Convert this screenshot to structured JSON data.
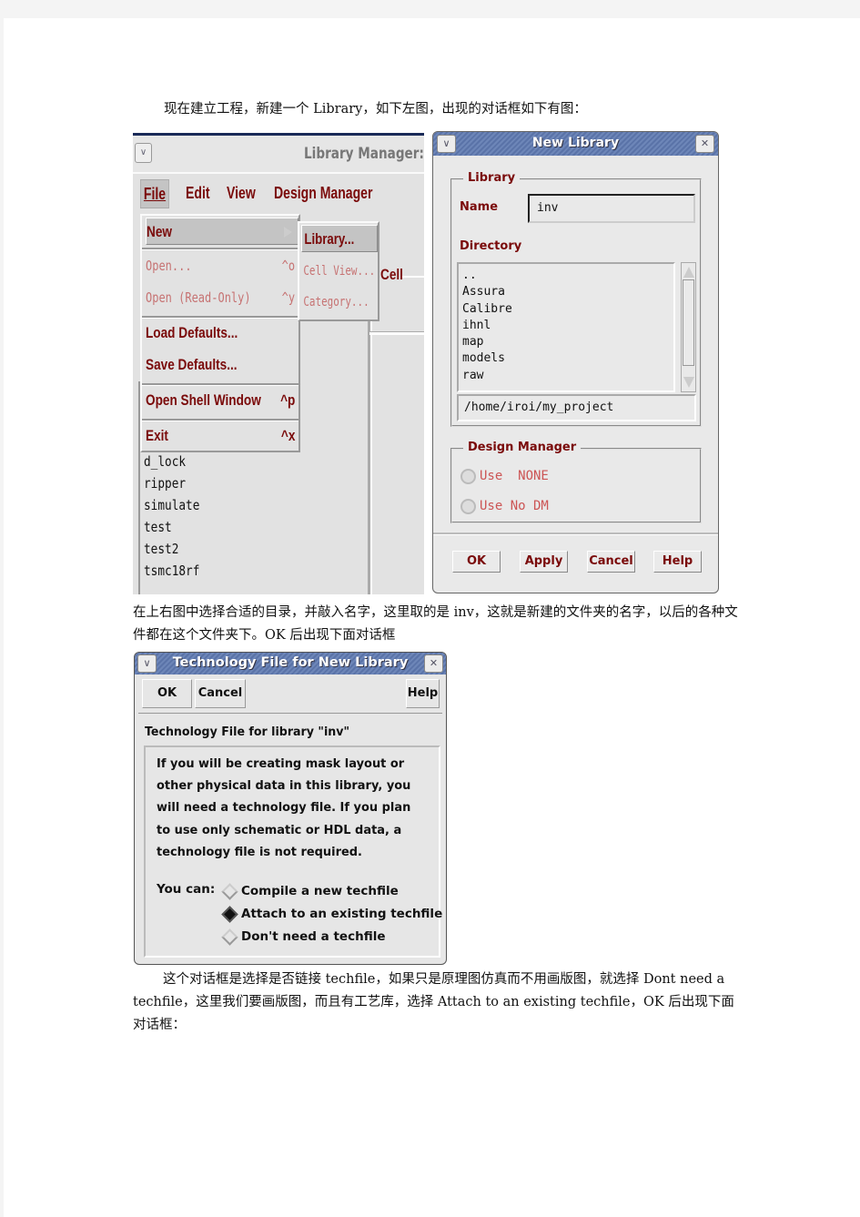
{
  "document": {
    "paragraph_1": "现在建立工程，新建一个 Library，如下左图，出现的对话框如下有图：",
    "paragraph_2": "在上右图中选择合适的目录，并敲入名字，这里取的是 inv，这就是新建的文件夹的名字，以后的各种文件都在这个文件夹下。OK 后出现下面对话框",
    "paragraph_3": "这个对话框是选择是否链接 techfile，如果只是原理图仿真而不用画版图，就选择 Dont need a techfile，这里我们要画版图，而且有工艺库，选择 Attach to an existing techfile，OK 后出现下面对话框："
  },
  "library_manager": {
    "window_menu_icon": "chevron-down-icon",
    "title": "Library Manager: W",
    "menubar": [
      {
        "label": "File",
        "mnemonic": "F"
      },
      {
        "label": "Edit",
        "mnemonic": "E"
      },
      {
        "label": "View",
        "mnemonic": "V"
      },
      {
        "label": "Design Manager",
        "mnemonic": "D"
      }
    ],
    "cell_label": "Cell",
    "file_menu": {
      "items": [
        {
          "label": "New",
          "shortcut": "",
          "state": "highlighted",
          "has_submenu": true
        },
        {
          "label": "Open...",
          "shortcut": "^o",
          "state": "disabled"
        },
        {
          "label": "Open (Read-Only)",
          "shortcut": "^y",
          "state": "disabled"
        },
        {
          "label": "Load Defaults...",
          "shortcut": "",
          "state": "enabled"
        },
        {
          "label": "Save Defaults...",
          "shortcut": "",
          "state": "enabled"
        },
        {
          "label": "Open Shell Window",
          "shortcut": "^p",
          "state": "enabled"
        },
        {
          "label": "Exit",
          "shortcut": "^x",
          "state": "enabled"
        }
      ]
    },
    "new_submenu": {
      "items": [
        {
          "label": "Library...",
          "state": "highlighted"
        },
        {
          "label": "Cell View...",
          "state": "disabled"
        },
        {
          "label": "Category...",
          "state": "disabled"
        }
      ]
    },
    "library_list": [
      "d_lock",
      "ripper",
      "simulate",
      "test",
      "test2",
      "tsmc18rf"
    ]
  },
  "new_library_dialog": {
    "title": "New Library",
    "window_menu_icon": "chevron-down-icon",
    "close_icon": "close-icon",
    "library_group": "Library",
    "name_label": "Name",
    "name_value": "inv",
    "directory_label": "Directory",
    "directory_items": [
      "..",
      "Assura",
      "Calibre",
      "ihnl",
      "map",
      "models",
      "raw"
    ],
    "directory_path": "/home/iroi/my_project",
    "design_manager_group": "Design Manager",
    "dm_options": [
      {
        "label": "Use  NONE",
        "selected": false,
        "enabled": false
      },
      {
        "label": "Use No DM",
        "selected": false,
        "enabled": false
      }
    ],
    "buttons": {
      "ok": "OK",
      "apply": "Apply",
      "cancel": "Cancel",
      "help": "Help"
    }
  },
  "techfile_dialog": {
    "title": "Technology File for New Library",
    "buttons": {
      "ok": "OK",
      "cancel": "Cancel",
      "help": "Help"
    },
    "heading": "Technology File for library \"inv\"",
    "message": "If you will be creating mask layout or other physical data in this library, you will need a technology file. If you plan to use only schematic or HDL data, a technology file is not required.",
    "you_can_label": "You can:",
    "options": [
      {
        "label": "Compile a new techfile",
        "selected": false
      },
      {
        "label": "Attach to an existing techfile",
        "selected": true
      },
      {
        "label": "Don't need a techfile",
        "selected": false
      }
    ]
  },
  "colors": {
    "menu_text": "#7a0a0a",
    "titlebar": "#5a73a8",
    "dialog_bg": "#e9e9e9"
  }
}
